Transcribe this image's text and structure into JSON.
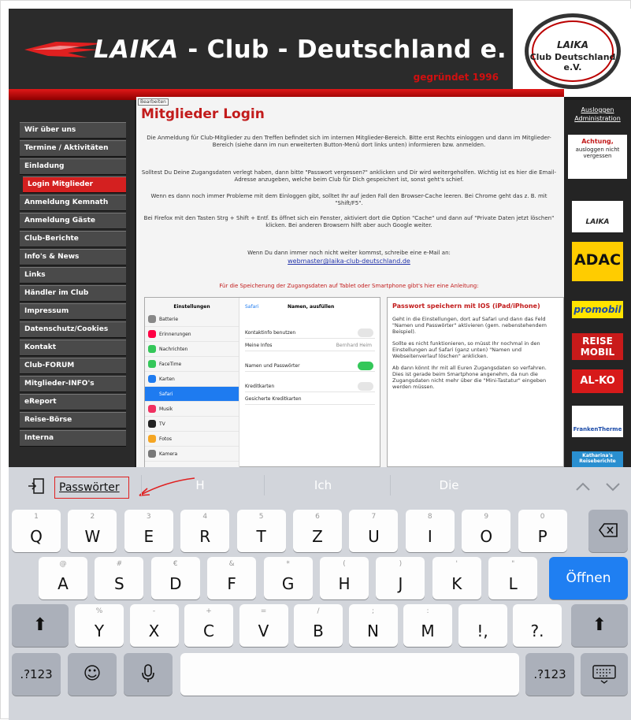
{
  "site": {
    "banner": {
      "title_brand": "LAIKA",
      "title_rest": "- Club - Deutschland e. V.",
      "founded": "gegründet 1996",
      "seal_brand": "LAIKA",
      "seal_text": "Club Deutschland e.V."
    },
    "menu": [
      {
        "label": "Wir über uns",
        "active": false
      },
      {
        "label": "Termine / Aktivitäten",
        "active": false
      },
      {
        "label": "Einladung",
        "active": false
      },
      {
        "label": "Login Mitglieder",
        "active": true
      },
      {
        "label": "Anmeldung Kemnath",
        "active": false
      },
      {
        "label": "Anmeldung Gäste",
        "active": false
      },
      {
        "label": "Club-Berichte",
        "active": false
      },
      {
        "label": "Info's & News",
        "active": false
      },
      {
        "label": "Links",
        "active": false
      },
      {
        "label": "Händler im Club",
        "active": false
      },
      {
        "label": "Impressum",
        "active": false
      },
      {
        "label": "Datenschutz/Cookies",
        "active": false
      },
      {
        "label": "Kontakt",
        "active": false
      },
      {
        "label": "Club-FORUM",
        "active": false
      },
      {
        "label": "Mitglieder-INFO's",
        "active": false
      },
      {
        "label": "eReport",
        "active": false
      },
      {
        "label": "Reise-Börse",
        "active": false
      },
      {
        "label": "Interna",
        "active": false
      }
    ],
    "content": {
      "badge": "Bearbeiten",
      "title": "Mitglieder Login",
      "p1": "Die Anmeldung für Club-Mitglieder zu den Treffen befindet sich im internen Mitglieder-Bereich. Bitte erst Rechts einloggen und dann im Mitglieder-Bereich (siehe dann im nun erweiterten Button-Menü dort links unten) informieren bzw. anmelden.",
      "p2": "Solltest Du Deine Zugangsdaten verlegt haben, dann bitte \"Passwort vergessen?\" anklicken und Dir wird weitergeholfen. Wichtig ist es hier die Email-Adresse anzugeben, welche beim Club für Dich gespeichert ist, sonst geht's schief.",
      "p3": "Wenn es dann noch immer Probleme mit dem Einloggen gibt, solltet Ihr auf jeden Fall den Browser-Cache leeren. Bei Chrome geht das z. B. mit \"Shift/F5\".",
      "p4": "Bei Firefox mit den Tasten Strg + Shift + Entf. Es öffnet sich ein Fenster, aktiviert dort die Option \"Cache\" und dann auf \"Private Daten jetzt löschen\" klicken. Bei anderen Browsern hilft aber auch Google weiter.",
      "p5": "Wenn Du dann immer noch nicht weiter kommst, schreibe eine e-Mail an:",
      "email": "webmaster@laika-club-deutschland.de",
      "p6": "Für die Speicherung der Zugangsdaten auf Tablet oder Smartphone gibt's hier eine Anleitung:",
      "shot": {
        "sidebar_title": "Einstellungen",
        "back": "Safari",
        "pane_title": "Namen, ausfüllen",
        "sidebar_rows": [
          "Batterie",
          "Erinnerungen",
          "Nachrichten",
          "FaceTime",
          "Karten",
          "Safari",
          "Musik",
          "TV",
          "Fotos",
          "Kamera"
        ],
        "pane_rows": [
          "Kontaktinfo benutzen",
          "Meine Infos",
          "Namen und Passwörter",
          "Kreditkarten",
          "Gesicherte Kreditkarten"
        ],
        "my_info_value": "Bernhard Heim"
      },
      "info": {
        "heading": "Passwort speichern mit IOS (iPad/iPhone)",
        "p1": "Geht in die Einstellungen, dort auf Safari und dann das Feld \"Namen und Passwörter\" aktivieren (gem. nebenstehendem Beispiel).",
        "p2": "Sollte es nicht funktionieren, so müsst Ihr nochmal in den Einstellungen auf Safari (ganz unten) \"Namen und Webseitenverlauf löschen\" anklicken.",
        "p3": "Ab dann könnt Ihr mit all Euren Zugangsdaten so verfahren. Dies ist gerade beim Smartphone angenehm, da nun die Zugangsdaten nicht mehr über die \"Mini-Tastatur\" eingeben werden müssen."
      }
    },
    "right": {
      "logout": "Ausloggen",
      "admin": "Administration",
      "achtung_title": "Achtung,",
      "achtung_text": "ausloggen nicht vergessen",
      "ads": [
        "LAIKA",
        "ADAC",
        "promobil",
        "REISE MOBIL",
        "AL-KO",
        "FrankenTherme",
        "Katharina's Reiseberichte"
      ]
    }
  },
  "keyboard": {
    "passwords": "Passwörter",
    "suggestions": [
      "H",
      "Ich",
      "Die"
    ],
    "row1": [
      {
        "hint": "1",
        "key": "Q"
      },
      {
        "hint": "2",
        "key": "W"
      },
      {
        "hint": "3",
        "key": "E"
      },
      {
        "hint": "4",
        "key": "R"
      },
      {
        "hint": "5",
        "key": "T"
      },
      {
        "hint": "6",
        "key": "Z"
      },
      {
        "hint": "7",
        "key": "U"
      },
      {
        "hint": "8",
        "key": "I"
      },
      {
        "hint": "9",
        "key": "O"
      },
      {
        "hint": "0",
        "key": "P"
      }
    ],
    "row2": [
      {
        "hint": "@",
        "key": "A"
      },
      {
        "hint": "#",
        "key": "S"
      },
      {
        "hint": "€",
        "key": "D"
      },
      {
        "hint": "&",
        "key": "F"
      },
      {
        "hint": "*",
        "key": "G"
      },
      {
        "hint": "(",
        "key": "H"
      },
      {
        "hint": ")",
        "key": "J"
      },
      {
        "hint": "'",
        "key": "K"
      },
      {
        "hint": "\"",
        "key": "L"
      }
    ],
    "row3": [
      {
        "hint": "%",
        "key": "Y"
      },
      {
        "hint": "-",
        "key": "X"
      },
      {
        "hint": "+",
        "key": "C"
      },
      {
        "hint": "=",
        "key": "V"
      },
      {
        "hint": "/",
        "key": "B"
      },
      {
        "hint": ";",
        "key": "N"
      },
      {
        "hint": ":",
        "key": "M"
      },
      {
        "hint": "",
        "key": "!,"
      },
      {
        "hint": "",
        "key": "?."
      }
    ],
    "open_label": "Öffnen",
    "numbers_label": ".?123",
    "colors": {
      "bg": "#d2d5db",
      "key": "#fdfdfd",
      "dark_key": "#abb0ba",
      "accent": "#1f7ff2",
      "highlight": "#e02020"
    }
  }
}
